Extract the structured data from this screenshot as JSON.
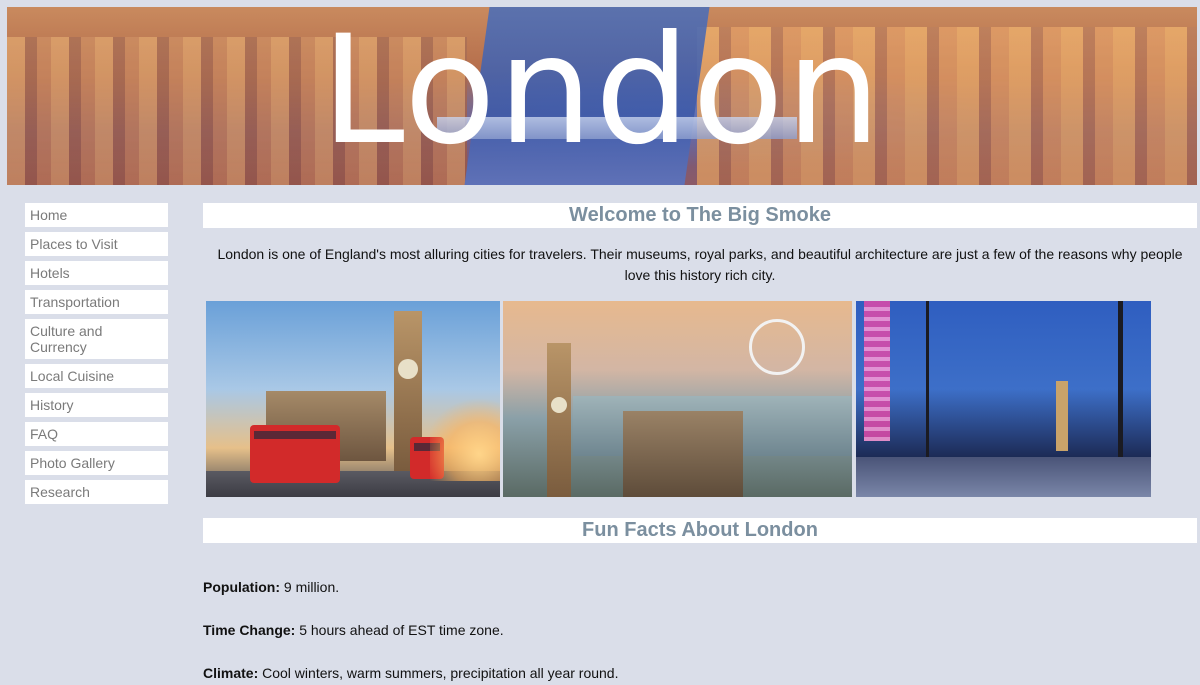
{
  "banner": {
    "title": "London"
  },
  "nav": {
    "items": [
      {
        "label": "Home"
      },
      {
        "label": "Places to Visit"
      },
      {
        "label": "Hotels"
      },
      {
        "label": "Transportation"
      },
      {
        "label": "Culture and Currency"
      },
      {
        "label": "Local Cuisine"
      },
      {
        "label": "History"
      },
      {
        "label": "FAQ"
      },
      {
        "label": "Photo Gallery"
      },
      {
        "label": "Research"
      }
    ]
  },
  "welcome": {
    "heading": "Welcome to The Big Smoke",
    "intro": "London is one of England's most alluring cities for travelers. Their museums, royal parks, and beautiful architecture are just a few of the reasons why people love this history rich city."
  },
  "photos": [
    {
      "name": "big-ben-buses-photo"
    },
    {
      "name": "london-eye-thames-photo"
    },
    {
      "name": "southbank-evening-photo"
    }
  ],
  "facts": {
    "heading": "Fun Facts About London",
    "items": [
      {
        "label": "Population:",
        "value": " 9 million."
      },
      {
        "label": "Time Change:",
        "value": " 5 hours ahead of EST time zone."
      },
      {
        "label": "Climate:",
        "value": " Cool winters, warm summers, precipitation all year round."
      }
    ]
  },
  "colors": {
    "page_background": "#dadee9",
    "heading_text": "#7b8f9f",
    "nav_text": "#7a7a7a"
  }
}
